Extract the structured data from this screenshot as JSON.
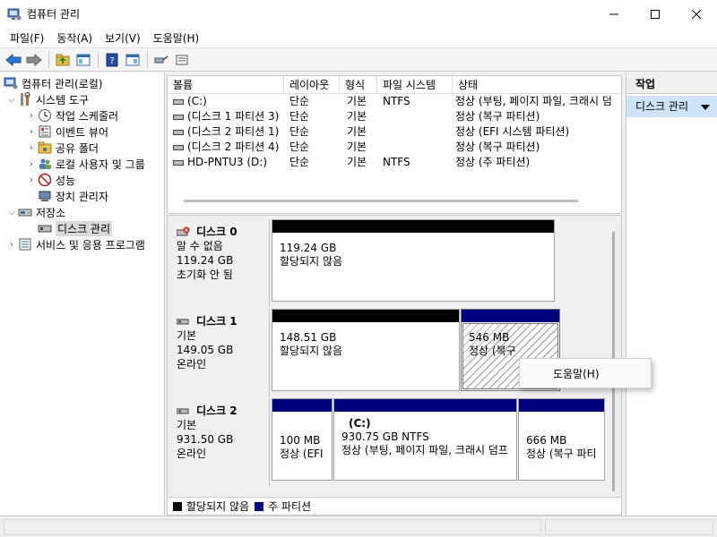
{
  "window": {
    "title": "컴퓨터 관리"
  },
  "menu": [
    "파일(F)",
    "동작(A)",
    "보기(V)",
    "도움말(H)"
  ],
  "tree": {
    "root": "컴퓨터 관리(로컬)",
    "system_tools": "시스템 도구",
    "task_scheduler": "작업 스케줄러",
    "event_viewer": "이벤트 뷰어",
    "shared_folders": "공유 폴더",
    "local_users": "로컬 사용자 및 그룹",
    "performance": "성능",
    "device_manager": "장치 관리자",
    "storage": "저장소",
    "disk_management": "디스크 관리",
    "services": "서비스 및 응용 프로그램"
  },
  "volumes": {
    "headers": [
      "볼륨",
      "레이아웃",
      "형식",
      "파일 시스템",
      "상태"
    ],
    "rows": [
      [
        "(C:)",
        "단순",
        "기본",
        "NTFS",
        "정상 (부팅, 페이지 파일, 크래시 덤"
      ],
      [
        "(디스크 1 파티션 3)",
        "단순",
        "기본",
        "",
        "정상 (복구 파티션)"
      ],
      [
        "(디스크 2 파티션 1)",
        "단순",
        "기본",
        "",
        "정상 (EFI 시스템 파티션)"
      ],
      [
        "(디스크 2 파티션 4)",
        "단순",
        "기본",
        "",
        "정상 (복구 파티션)"
      ],
      [
        "HD-PNTU3 (D:)",
        "단순",
        "기본",
        "NTFS",
        "정상 (주 파티션)"
      ]
    ]
  },
  "disks": [
    {
      "name": "디스크 0",
      "type": "알 수 없음",
      "size": "119.24 GB",
      "status": "초기화 안 됨",
      "partitions": [
        {
          "line1": "119.24 GB",
          "line2": "할당되지 않음",
          "line3": ""
        }
      ]
    },
    {
      "name": "디스크 1",
      "type": "기본",
      "size": "149.05 GB",
      "status": "온라인",
      "partitions": [
        {
          "line1": "148.51 GB",
          "line2": "할당되지 않음",
          "line3": ""
        },
        {
          "line1": "546 MB",
          "line2": "정상 (복구",
          "line3": ""
        }
      ]
    },
    {
      "name": "디스크 2",
      "type": "기본",
      "size": "931.50 GB",
      "status": "온라인",
      "partitions": [
        {
          "line1": "100 MB",
          "line2": "정상 (EFI",
          "line3": ""
        },
        {
          "line1": "(C:)",
          "line2": "930.75 GB NTFS",
          "line3": "정상 (부팅, 페이지 파일, 크래시 덤프"
        },
        {
          "line1": "666 MB",
          "line2": "정상 (복구 파티",
          "line3": ""
        }
      ]
    }
  ],
  "legend": [
    {
      "label": "할당되지 않음",
      "color": "#000000"
    },
    {
      "label": "주 파티션",
      "color": "#00007f"
    }
  ],
  "actions": {
    "header": "작업",
    "item": "디스크 관리"
  },
  "context_menu": {
    "help": "도움말(H)"
  },
  "colors": {
    "unallocated": "#000000",
    "primary": "#00007f",
    "selection": "#cde3f7"
  }
}
